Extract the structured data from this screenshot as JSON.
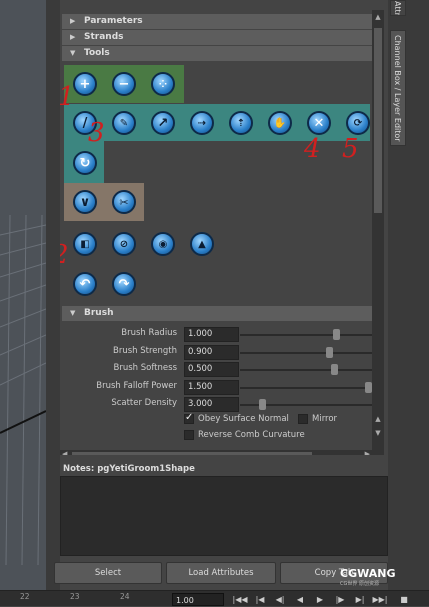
{
  "frames": {
    "parameters": "Parameters",
    "strands": "Strands",
    "tools": "Tools",
    "brush": "Brush"
  },
  "annotations": [
    "1",
    "2",
    "3",
    "4",
    "5"
  ],
  "tool_icons": {
    "row1": [
      "add-icon",
      "remove-icon",
      "scatter-icon"
    ],
    "row2": [
      "comb-icon",
      "cut-icon",
      "scale-icon",
      "move-icon",
      "lift-icon",
      "clump-icon",
      "grab-icon",
      "scissors-icon",
      "twist-icon"
    ],
    "row3": [
      "refresh-icon"
    ],
    "row4": [
      "direction-icon",
      "bend-icon"
    ],
    "row5": [
      "attenuate-icon",
      "block-icon",
      "rotate-icon",
      "split-icon"
    ],
    "row6": [
      "undo-icon",
      "redo-icon"
    ]
  },
  "highlight_colors": {
    "green": "#4a7a44",
    "teal": "#3c8680",
    "tan": "#857668"
  },
  "brush_attrs": [
    {
      "label": "Brush Radius",
      "value": "1.000",
      "slider": 0.74
    },
    {
      "label": "Brush Strength",
      "value": "0.900",
      "slider": 0.68
    },
    {
      "label": "Brush Softness",
      "value": "0.500",
      "slider": 0.72
    },
    {
      "label": "Brush Falloff Power",
      "value": "1.500",
      "slider": 0.99
    },
    {
      "label": "Scatter Density",
      "value": "3.000",
      "slider": 0.15
    }
  ],
  "checks": {
    "obey_surface_normal": {
      "label": "Obey Surface Normal",
      "checked": true
    },
    "mirror": {
      "label": "Mirror",
      "checked": false
    },
    "reverse_comb": {
      "label": "Reverse Comb Curvature",
      "checked": false
    }
  },
  "notes_label": "Notes:  pgYetiGroom1Shape",
  "buttons": {
    "select": "Select",
    "load_attributes": "Load Attributes",
    "copy_tab": "Copy Tab"
  },
  "right_tabs": {
    "attribute_editor": "Attribute Editor",
    "channel_box": "Channel Box / Layer Editor"
  },
  "timeline": {
    "ticks": [
      "22",
      "23",
      "24"
    ],
    "current_frame": "1.00"
  },
  "watermark": {
    "brand": "CGWANG",
    "sub": "CG世界 原创资源"
  }
}
